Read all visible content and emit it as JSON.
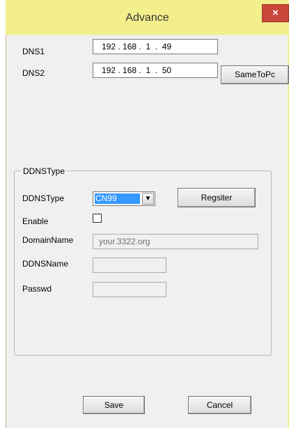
{
  "window": {
    "title": "Advance",
    "close_glyph": "×"
  },
  "dns": {
    "dns1_label": "DNS1",
    "dns1_value": "192 . 168 .  1  .  49",
    "dns2_label": "DNS2",
    "dns2_value": "192 . 168 .  1  .  50",
    "same_to_pc_label": "SameToPc"
  },
  "ddns": {
    "group_title": "DDNSType",
    "type_label": "DDNSType",
    "type_value": "CN99",
    "register_label": "Regsiter",
    "enable_label": "Enable",
    "enable_checked": false,
    "domain_label": "DomainName",
    "domain_value": "your.3322.org",
    "ddnsname_label": "DDNSName",
    "ddnsname_value": "",
    "passwd_label": "Passwd",
    "passwd_value": ""
  },
  "footer": {
    "save_label": "Save",
    "cancel_label": "Cancel"
  },
  "icons": {
    "dropdown_arrow": "▼"
  },
  "colors": {
    "title_bar": "#f3ef8c",
    "close_button": "#c7473a",
    "dialog_bg": "#f0f0f0",
    "selection": "#3399ff"
  }
}
